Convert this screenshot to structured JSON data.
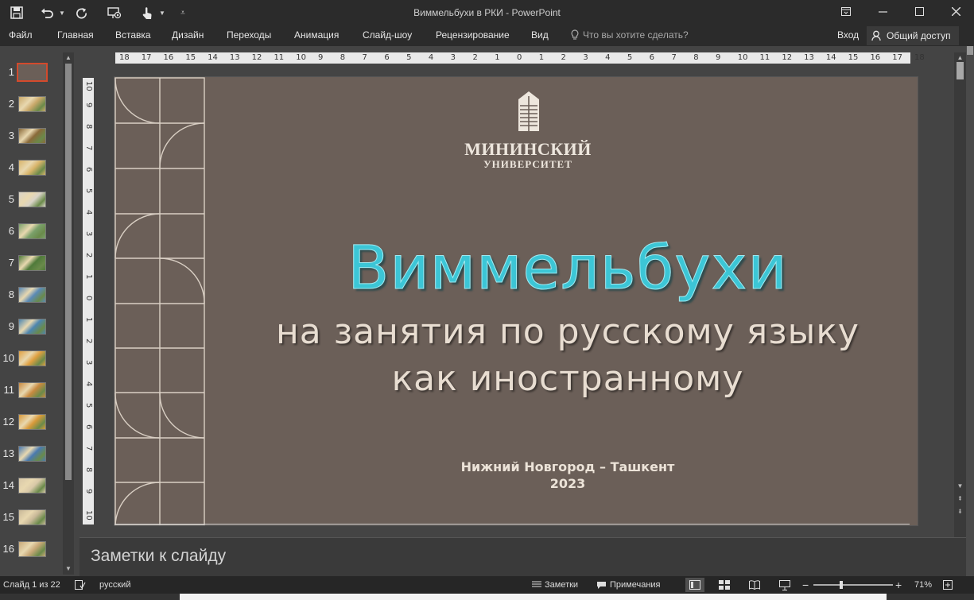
{
  "window": {
    "title": "Виммельбухи в РКИ - PowerPoint",
    "controls": {
      "ribbon_display": "▣",
      "minimize": "—",
      "maximize": "☐",
      "close": "✕"
    }
  },
  "quick_access": {
    "save_icon": "floppy-disk",
    "undo_icon": "undo-arrow",
    "redo_icon": "redo-circular-arrow",
    "present_icon": "slideshow-from-start",
    "touch_icon": "touch-mode",
    "customize_icon": "customize-qat"
  },
  "ribbon": {
    "tabs": [
      "Файл",
      "Главная",
      "Вставка",
      "Дизайн",
      "Переходы",
      "Анимация",
      "Слайд-шоу",
      "Рецензирование",
      "Вид"
    ],
    "tell_me_placeholder": "Что вы хотите сделать?",
    "sign_in": "Вход",
    "share": "Общий доступ"
  },
  "thumbnails": {
    "numbers": [
      "1",
      "2",
      "3",
      "4",
      "5",
      "6",
      "7",
      "8",
      "9",
      "10",
      "11",
      "12",
      "13",
      "14",
      "15",
      "16"
    ],
    "active_index": 1,
    "colors": [
      "#6b5f58",
      "#c9a86a",
      "#8a6a3a",
      "#d8b46a",
      "#d9d3c7",
      "#7aa06a",
      "#4f7a3a",
      "#5b8ab6",
      "#4d86b0",
      "#e0a040",
      "#c88a40",
      "#d89a3a",
      "#4a7ab0",
      "#d8c8a8",
      "#c8b898",
      "#c8a878"
    ]
  },
  "rulers": {
    "horizontal": [
      "18",
      "17",
      "16",
      "15",
      "14",
      "13",
      "12",
      "11",
      "10",
      "9",
      "8",
      "7",
      "6",
      "5",
      "4",
      "3",
      "2",
      "1",
      "0",
      "1",
      "2",
      "3",
      "4",
      "5",
      "6",
      "7",
      "8",
      "9",
      "10",
      "11",
      "12",
      "13",
      "14",
      "15",
      "16",
      "17",
      "18"
    ],
    "vertical": [
      "10",
      "9",
      "8",
      "7",
      "6",
      "5",
      "4",
      "3",
      "2",
      "1",
      "0",
      "1",
      "2",
      "3",
      "4",
      "5",
      "6",
      "7",
      "8",
      "9",
      "10"
    ]
  },
  "slide": {
    "background": "#6b5f58",
    "logo_line1": "МИНИНСКИЙ",
    "logo_line2": "УНИВЕРСИТЕТ",
    "title": "Виммельбухи",
    "subtitle_line1": "на занятия по русскому языку",
    "subtitle_line2": "как иностранному",
    "place": "Нижний Новгород – Ташкент",
    "year": "2023",
    "title_color": "#3cc6d6"
  },
  "notes": {
    "placeholder": "Заметки к слайду"
  },
  "status": {
    "slide_counter": "Слайд 1 из 22",
    "language": "русский",
    "notes_button": "Заметки",
    "comments_button": "Примечания",
    "zoom_percent": "71%",
    "zoom_fraction": 0.35
  }
}
